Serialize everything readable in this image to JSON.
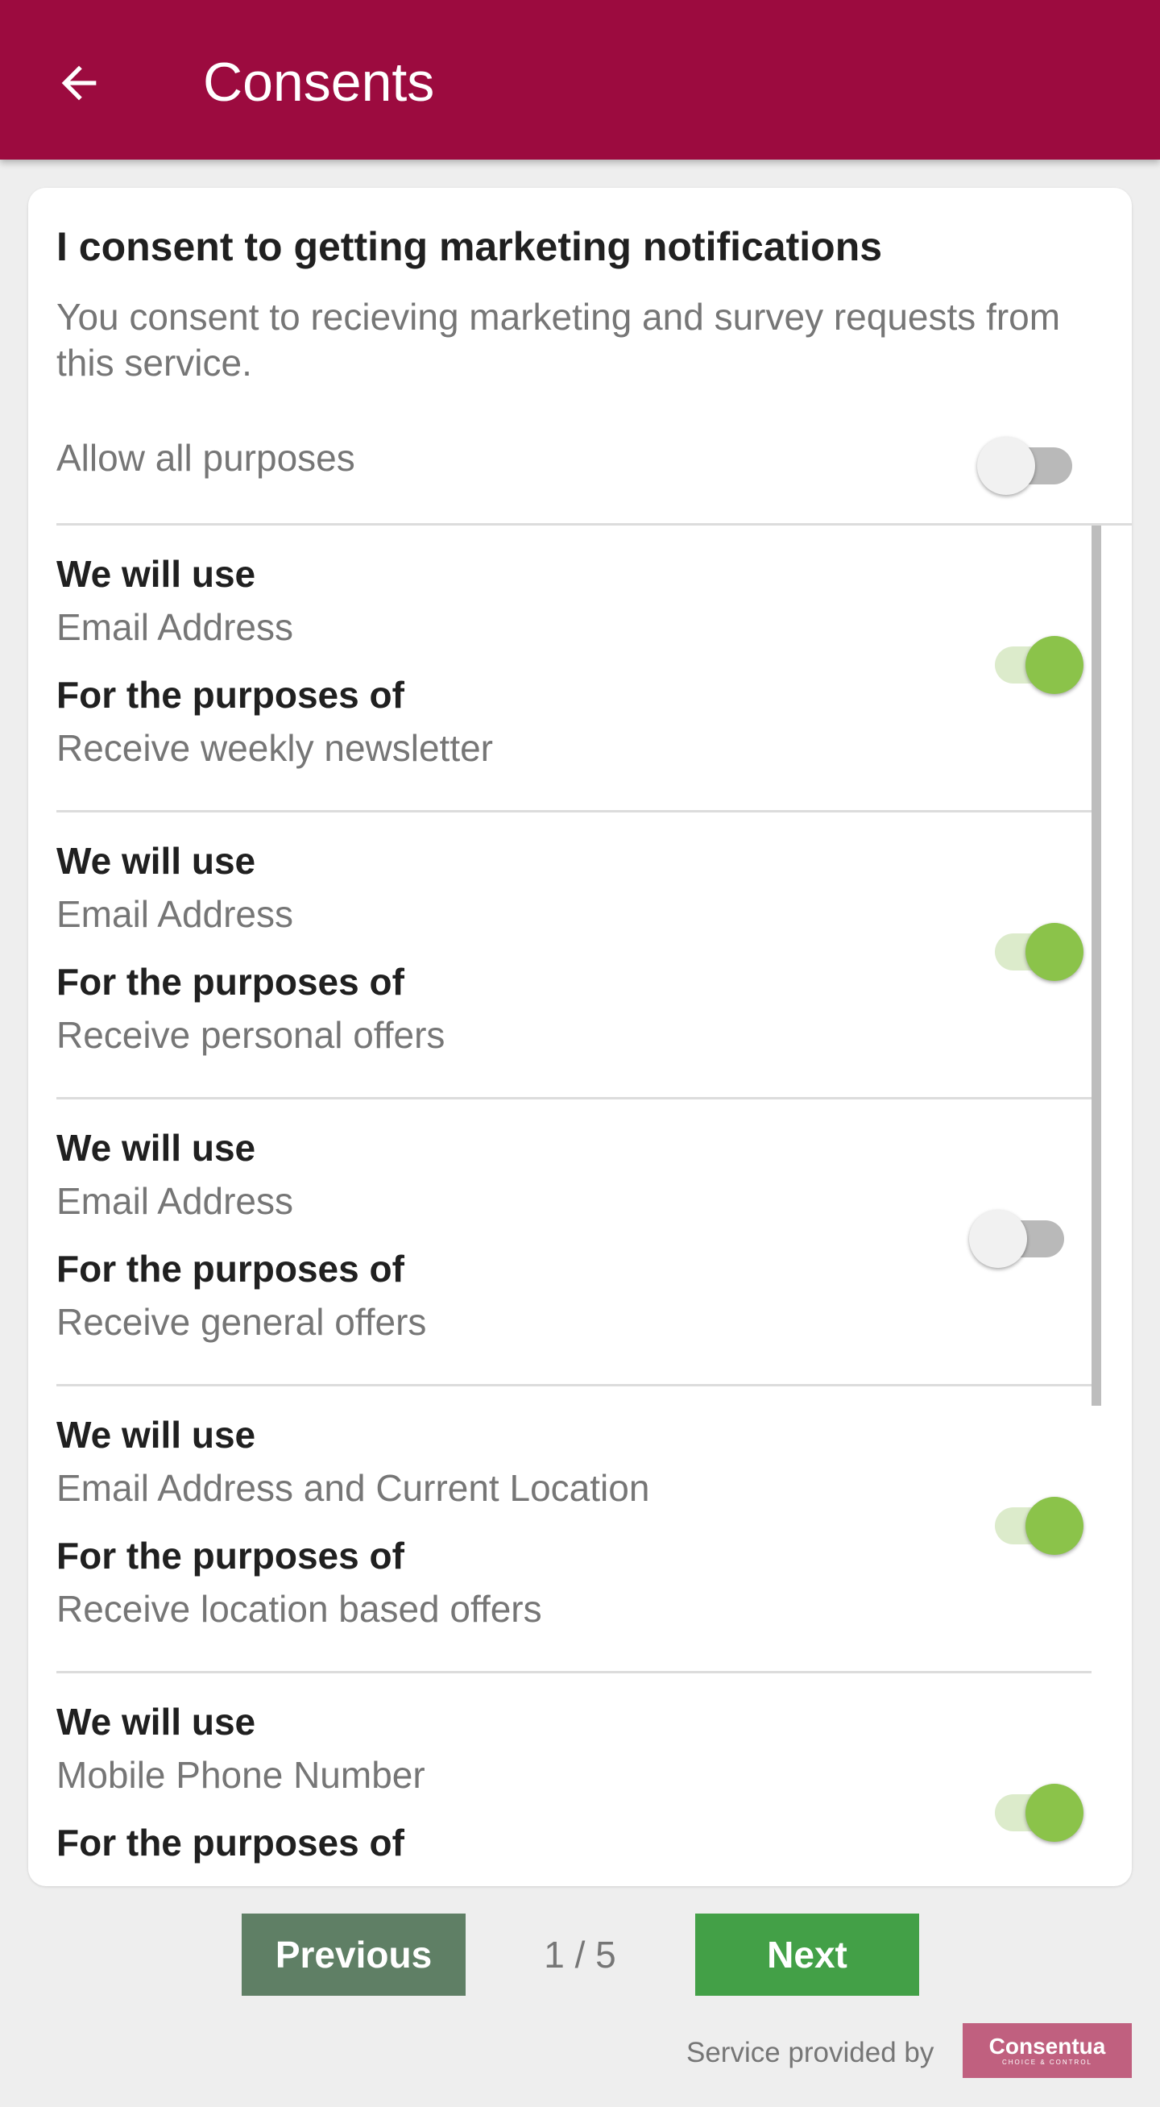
{
  "appbar": {
    "title": "Consents",
    "back_icon": "arrow-back-icon"
  },
  "card": {
    "title": "I consent to getting marketing notifications",
    "description": "You consent to recieving marketing and survey requests from this service.",
    "allow_all": {
      "label": "Allow all purposes",
      "on": false
    }
  },
  "labels": {
    "we_will_use": "We will use",
    "for_purposes": "For the purposes of"
  },
  "purposes": [
    {
      "data": "Email Address",
      "purpose": "Receive weekly newsletter",
      "on": true
    },
    {
      "data": "Email Address",
      "purpose": "Receive personal offers",
      "on": true
    },
    {
      "data": "Email Address",
      "purpose": "Receive general offers",
      "on": false
    },
    {
      "data": "Email Address and Current Location",
      "purpose": "Receive location based offers",
      "on": true
    },
    {
      "data": "Mobile Phone Number",
      "purpose": "",
      "on": true
    }
  ],
  "pager": {
    "previous": "Previous",
    "next": "Next",
    "indicator": "1 / 5"
  },
  "footer": {
    "service_text": "Service provided by",
    "brand_name": "Consentua",
    "brand_tagline": "CHOICE & CONTROL"
  },
  "colors": {
    "appbar": "#9c0b3f",
    "toggle_on": "#8bc34a",
    "prev_button": "#5f7f65",
    "next_button": "#43a047",
    "brand": "#c0607f"
  }
}
